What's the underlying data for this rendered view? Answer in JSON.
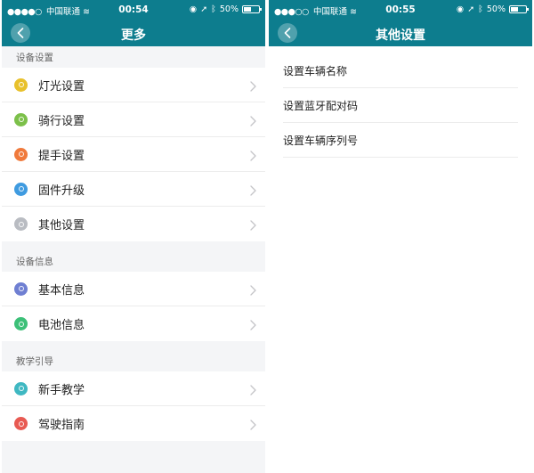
{
  "left_screen": {
    "status": {
      "carrier": "中国联通",
      "time": "00:54",
      "battery": "50%",
      "battery_level": 0.5
    },
    "nav": {
      "title": "更多"
    },
    "sections": [
      {
        "header": "设备设置",
        "items": [
          {
            "label": "灯光设置",
            "icon": "bulb-icon",
            "color": "#e8c12c"
          },
          {
            "label": "骑行设置",
            "icon": "riding-icon",
            "color": "#7cc04a"
          },
          {
            "label": "提手设置",
            "icon": "handle-icon",
            "color": "#f07a3c"
          },
          {
            "label": "固件升级",
            "icon": "firmware-icon",
            "color": "#3f9be0"
          },
          {
            "label": "其他设置",
            "icon": "other-settings-icon",
            "color": "#b9bcc2"
          }
        ]
      },
      {
        "header": "设备信息",
        "items": [
          {
            "label": "基本信息",
            "icon": "info-icon",
            "color": "#6f7fd2"
          },
          {
            "label": "电池信息",
            "icon": "battery-info-icon",
            "color": "#3cc078"
          }
        ]
      },
      {
        "header": "教学引导",
        "items": [
          {
            "label": "新手教学",
            "icon": "tutorial-icon",
            "color": "#3fb8c2"
          },
          {
            "label": "驾驶指南",
            "icon": "driving-guide-icon",
            "color": "#e85a52"
          }
        ]
      }
    ]
  },
  "right_screen": {
    "status": {
      "carrier": "中国联通",
      "time": "00:55",
      "battery": "50%",
      "battery_level": 0.5
    },
    "nav": {
      "title": "其他设置"
    },
    "items": [
      {
        "label": "设置车辆名称"
      },
      {
        "label": "设置蓝牙配对码"
      },
      {
        "label": "设置车辆序列号"
      }
    ]
  }
}
